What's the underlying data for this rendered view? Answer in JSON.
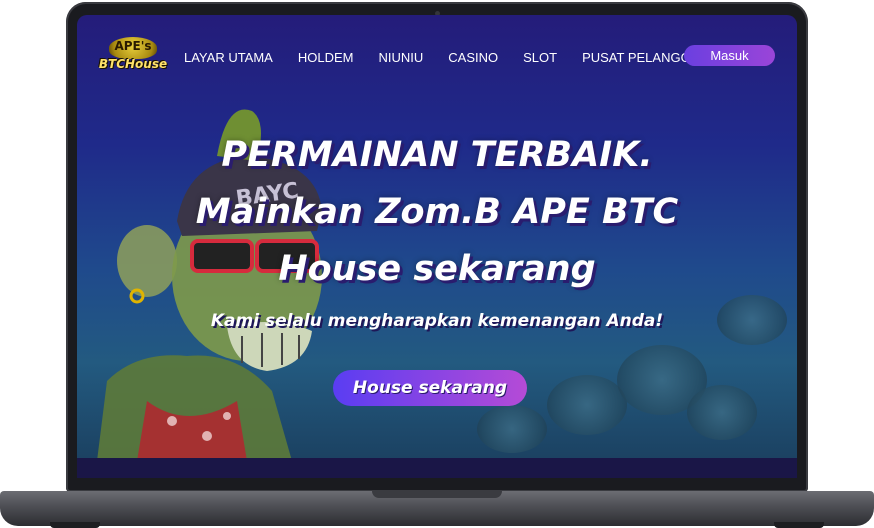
{
  "nav": {
    "logo_top": "APE's",
    "logo_bottom": "BTCHouse",
    "items": [
      "LAYAR UTAMA",
      "HOLDEM",
      "NIUNIU",
      "CASINO",
      "SLOT",
      "PUSAT PELANGGAN"
    ],
    "login_label": "Masuk"
  },
  "hero": {
    "title_line1": "PERMAINAN TERBAIK.",
    "title_line2": "Mainkan Zom.B APE BTC",
    "title_line3": "House sekarang",
    "subtitle": "Kami selalu mengharapkan kemenangan Anda!",
    "cta_label": "House sekarang"
  },
  "colors": {
    "accent_start": "#5a3df2",
    "accent_end": "#b54bd6",
    "hero_bg_top": "#241c7a",
    "hero_bg_bottom": "#1a3d5c"
  },
  "icons": {
    "logo": "apes-btchouse-logo",
    "mascot": "zombie-ape-illustration"
  }
}
